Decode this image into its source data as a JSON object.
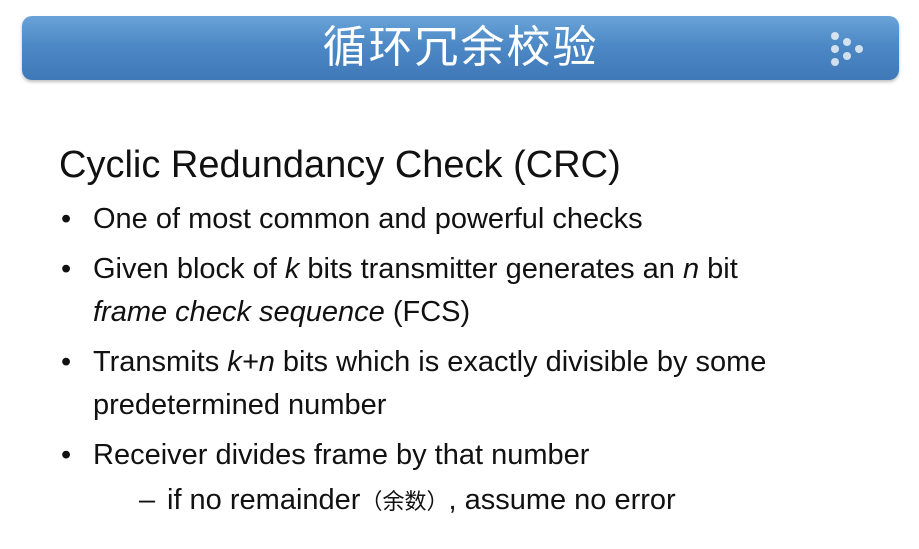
{
  "slide": {
    "title": "循环冗余校验",
    "heading": "Cyclic Redundancy Check (CRC)",
    "bullet_marker": "•",
    "sub_marker": "–",
    "bullets": [
      {
        "text": "One of most common and powerful checks"
      },
      {
        "part1": "Given block of ",
        "k": "k",
        "part2": " bits transmitter generates an ",
        "n": "n",
        "part3": " bit",
        "part4": "frame check sequence",
        "part5": " (FCS)"
      },
      {
        "part1": "Transmits ",
        "kn": "k+n",
        "part2": " bits which is exactly divisible by some",
        "part3": "predetermined number"
      },
      {
        "text": "Receiver divides frame by that number"
      }
    ],
    "sub_bullet": {
      "part1": "if no remainder",
      "cn": "（余数）",
      "part2": ", assume no error"
    }
  }
}
